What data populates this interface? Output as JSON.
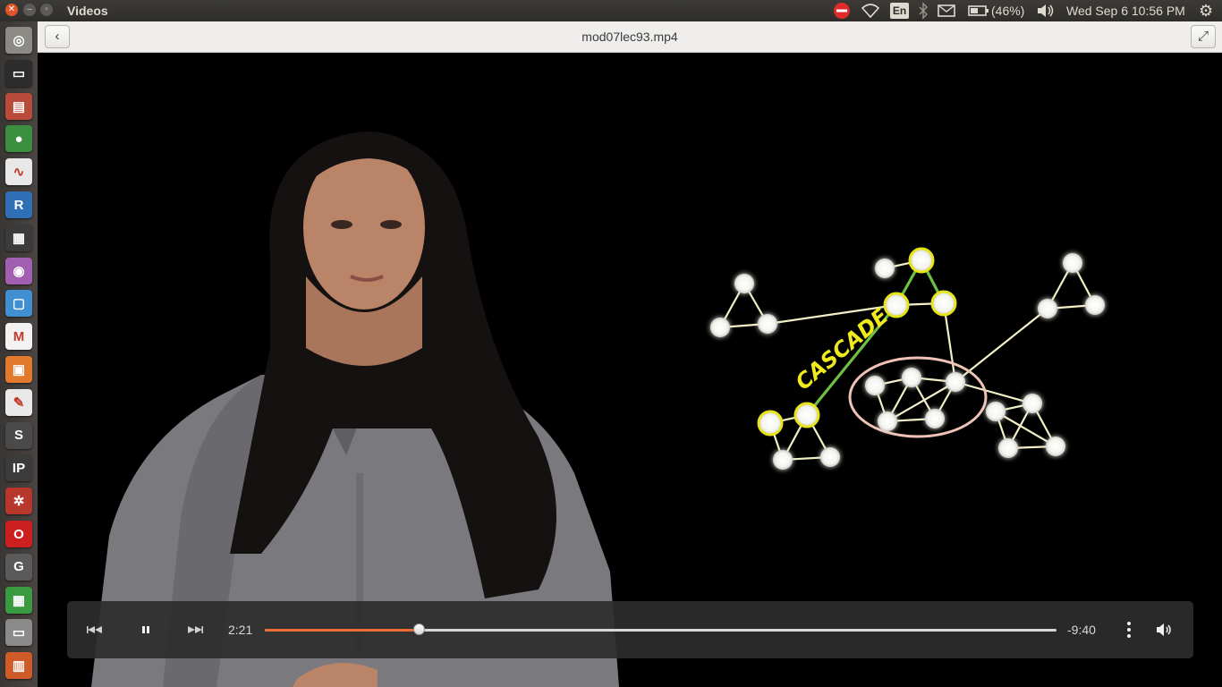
{
  "panel": {
    "app_title": "Videos",
    "keyboard_layout": "En",
    "battery_percent": "(46%)",
    "clock": "Wed Sep  6 10:56 PM",
    "icons": [
      "do-not-disturb-icon",
      "wifi-icon",
      "keyboard-icon",
      "bluetooth-icon",
      "mail-icon",
      "battery-icon",
      "volume-icon",
      "settings-gear-icon"
    ]
  },
  "launcher": {
    "items": [
      {
        "name": "dash-home-icon",
        "glyph": "◎",
        "color": "#8c8a85"
      },
      {
        "name": "terminal-icon",
        "glyph": "▭",
        "color": "#2c2c2c"
      },
      {
        "name": "archive-manager-icon",
        "glyph": "▤",
        "color": "#b84b3a"
      },
      {
        "name": "chrome-icon",
        "glyph": "●",
        "color": "#3b8f3e"
      },
      {
        "name": "screenshot-viewer-icon",
        "glyph": "∿",
        "color": "#e8e8e8"
      },
      {
        "name": "r-icon",
        "glyph": "R",
        "color": "#2f6fb5"
      },
      {
        "name": "video-editor-icon",
        "glyph": "▦",
        "color": "#3b3b3b"
      },
      {
        "name": "media-player-icon",
        "glyph": "◉",
        "color": "#a05fb0"
      },
      {
        "name": "writer-doc-icon",
        "glyph": "▢",
        "color": "#3f8fd1"
      },
      {
        "name": "gmail-icon",
        "glyph": "M",
        "color": "#f2f2f2"
      },
      {
        "name": "impress-icon",
        "glyph": "▣",
        "color": "#e27a2e"
      },
      {
        "name": "text-editor-icon",
        "glyph": "✎",
        "color": "#e9e9e9"
      },
      {
        "name": "sublime-text-icon",
        "glyph": "S",
        "color": "#4a4a4a"
      },
      {
        "name": "ipython-icon",
        "glyph": "IP",
        "color": "#3b3b3b"
      },
      {
        "name": "network-tool-icon",
        "glyph": "✲",
        "color": "#b7372c"
      },
      {
        "name": "opera-icon",
        "glyph": "O",
        "color": "#cc1f1f"
      },
      {
        "name": "gephi-icon",
        "glyph": "G",
        "color": "#5a5a5a"
      },
      {
        "name": "spreadsheet-icon",
        "glyph": "▦",
        "color": "#3a9a3f"
      },
      {
        "name": "drive-icon",
        "glyph": "▭",
        "color": "#8a8a8a"
      },
      {
        "name": "trash-icon",
        "glyph": "▥",
        "color": "#cf5b2a"
      }
    ]
  },
  "header": {
    "back_icon": "back-arrow-icon",
    "file_title": "mod07lec93.mp4",
    "fullscreen_icon": "fullscreen-icon"
  },
  "video_content": {
    "cascade_label": "CASCADE"
  },
  "controls": {
    "elapsed": "2:21",
    "remaining": "-9:40",
    "progress_fraction": 0.195,
    "accent_color": "#ed6b35",
    "icons": [
      "skip-back-icon",
      "pause-icon",
      "skip-forward-icon",
      "more-options-icon",
      "volume-icon"
    ]
  }
}
